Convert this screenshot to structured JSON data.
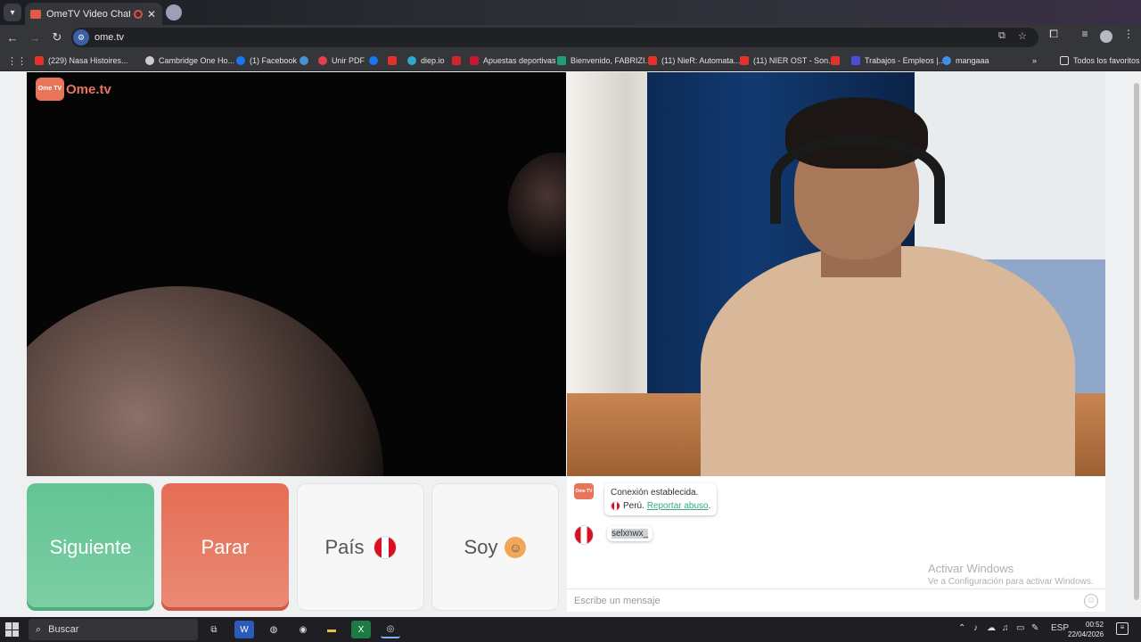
{
  "browser": {
    "tab_title": "OmeTV Video Chat — Ome",
    "url": "ome.tv",
    "bookmarks": [
      {
        "label": "(229) Nasa Histoires...",
        "icon": "youtube-icon"
      },
      {
        "label": "Cambridge One Ho...",
        "icon": "cambridge-icon"
      },
      {
        "label": "(1) Facebook",
        "icon": "facebook-icon"
      },
      {
        "label": "",
        "icon": "site-icon"
      },
      {
        "label": "Unir PDF",
        "icon": "heart-icon"
      },
      {
        "label": "",
        "icon": "facebook-icon"
      },
      {
        "label": "",
        "icon": "youtube-icon"
      },
      {
        "label": "diep.io",
        "icon": "diep-icon"
      },
      {
        "label": "",
        "icon": "alert-icon"
      },
      {
        "label": "Apuestas deportivas",
        "icon": "bet-icon"
      },
      {
        "label": "Bienvenido, FABRIZI...",
        "icon": "a-icon"
      },
      {
        "label": "(11) NieR: Automata...",
        "icon": "youtube-icon"
      },
      {
        "label": "(11) NIER OST - Son...",
        "icon": "youtube-icon"
      },
      {
        "label": "",
        "icon": "youtube-icon"
      },
      {
        "label": "Trabajos - Empleos |...",
        "icon": "jobs-icon"
      },
      {
        "label": "mangaaa",
        "icon": "manga-icon"
      }
    ],
    "all_bookmarks_label": "Todos los favoritos"
  },
  "app": {
    "logo_text": "Ome.tv",
    "logo_badge": "Ome TV"
  },
  "controls": {
    "next_label": "Siguiente",
    "stop_label": "Parar",
    "country_label": "País",
    "gender_label": "Soy"
  },
  "chat": {
    "system_message": "Conexión establecida.",
    "country": "Perú.",
    "report_link": "Reportar abuso",
    "report_suffix": ".",
    "user_message": "selxnwx_",
    "input_placeholder": "Escribe un mensaje",
    "watermark_title": "Activar Windows",
    "watermark_subtitle": "Ve a Configuración para activar Windows."
  },
  "taskbar": {
    "search_label": "Buscar",
    "language": "ESP",
    "time": "00:52",
    "date": "22/04/2026"
  },
  "colors": {
    "next_button": "#62c493",
    "stop_button": "#e56d56",
    "brand": "#e8745a",
    "link": "#3ba886"
  }
}
